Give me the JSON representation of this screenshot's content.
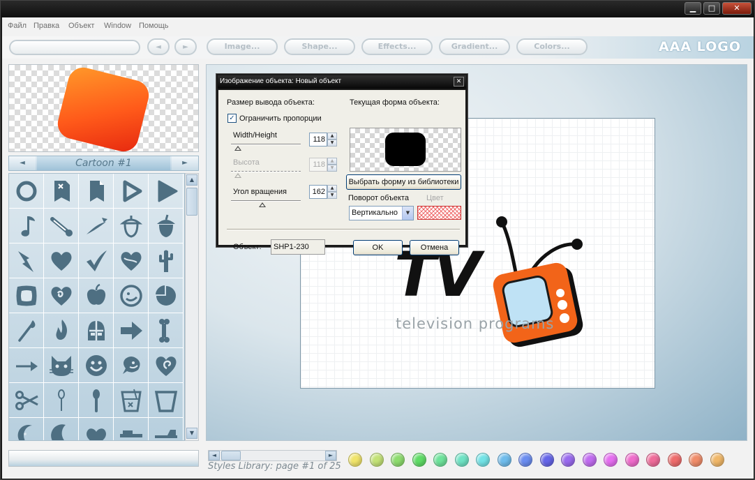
{
  "window": {
    "controls": {
      "minimize": "▁",
      "maximize": "□",
      "close": "✕"
    }
  },
  "menu": [
    "Файл",
    "Правка",
    "Объект",
    "Window",
    "Помощь"
  ],
  "toolbar": {
    "prev": "◄",
    "next": "►",
    "buttons": [
      "Image...",
      "Shape...",
      "Effects...",
      "Gradient...",
      "Colors..."
    ],
    "app_logo": "AAA LOGO"
  },
  "library": {
    "prev": "◄",
    "next": "►",
    "title": "Cartoon #1",
    "scroll_up": "▲",
    "scroll_down": "▼",
    "shapes": [
      "circle-ring-icon",
      "paper-x-icon",
      "paper-folded-icon",
      "play-outline-icon",
      "play-icon",
      "music-note-icon",
      "thermometer-icon",
      "comet-icon",
      "acorn-outline-icon",
      "acorn-icon",
      "arrow-bolt-icon",
      "heart-icon",
      "checkmark-icon",
      "heart-split-icon",
      "cactus-icon",
      "frame-square-icon",
      "heart-swirl-icon",
      "apple-icon",
      "smiley-outline-icon",
      "pie-circle-icon",
      "match-icon",
      "flame-icon",
      "knight-helmet-icon",
      "arrow-right-icon",
      "bone-icon",
      "arrow-thin-icon",
      "cat-face-icon",
      "smiley-icon",
      "speech-face-icon",
      "heart-spiral-icon",
      "scissors-icon",
      "spoon-outline-icon",
      "spoon-icon",
      "glass-drink-icon",
      "glass-icon",
      "moon-face-icon",
      "moon-icon",
      "heart-blob-icon",
      "hammer-icon",
      "axe-icon"
    ]
  },
  "colors": {
    "swatches": [
      "#f0e46a",
      "#c3e277",
      "#8ddc6e",
      "#5fdc66",
      "#6ee39b",
      "#6fe3c4",
      "#72e3e6",
      "#6fbcec",
      "#6b8df0",
      "#6565e8",
      "#9a6bee",
      "#c16cf0",
      "#e56ef0",
      "#ef6ccb",
      "#ef6c9a",
      "#ee6c6c",
      "#f08d6a",
      "#f0b768"
    ]
  },
  "canvas": {
    "h_scroll_left": "◄",
    "h_scroll_right": "►",
    "styles_label": "Styles Library: page #1 of 25",
    "logo_text": "TV",
    "tagline": "television programs"
  },
  "dialog": {
    "title": "Изображение объекта: Новый объект",
    "close": "✕",
    "output_size_label": "Размер вывода объекта:",
    "constrain_label": "Ограничить пропорции",
    "constrain_checked": "✓",
    "width_height_label": "Width/Height",
    "width_height_value": "118",
    "height_label": "Высота",
    "height_value": "118",
    "rotation_label": "Угол вращения",
    "rotation_value": "162",
    "current_shape_label": "Текущая форма объекта:",
    "choose_shape_button": "Выбрать форму из библиотеки",
    "rotation_dir_label": "Поворот объекта",
    "rotation_dir_value": "Вертикально",
    "color_label": "Цвет",
    "object_label": "Объект:",
    "object_value": "SHP1-230",
    "ok_button": "OK",
    "cancel_button": "Отмена",
    "spin_up": "▲",
    "spin_down": "▼",
    "select_arrow": "▼"
  }
}
